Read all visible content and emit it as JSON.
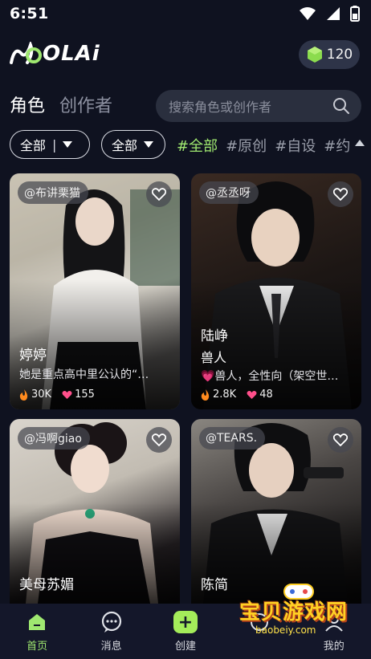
{
  "status": {
    "time": "6:51"
  },
  "header": {
    "logo_text": "OLAi",
    "logo_prefix": "M",
    "coins": "120"
  },
  "tabs": {
    "active": "角色",
    "inactive": "创作者"
  },
  "search": {
    "placeholder": "搜索角色或创作者"
  },
  "filters": {
    "dropdown1": "全部",
    "dropdown2": "全部",
    "hashtags": [
      "#全部",
      "#原创",
      "#自设",
      "#约"
    ]
  },
  "cards": [
    {
      "author": "@布讲栗猫",
      "name": "婷婷",
      "desc": "她是重点高中里公认的“…",
      "hot": "30K",
      "likes": "155"
    },
    {
      "author": "@丞丞呀",
      "name": "陆峥",
      "subtitle": "兽人",
      "desc": "💗兽人，全性向（架空世…",
      "hot": "2.8K",
      "likes": "48"
    },
    {
      "author": "@冯啊giao",
      "name": "美母苏媚",
      "desc": ""
    },
    {
      "author": "@TEARS.",
      "name": "陈简",
      "desc": ""
    }
  ],
  "nav": {
    "home": "首页",
    "messages": "消息",
    "create": "创建",
    "discover": "",
    "mine": "我的"
  },
  "watermark": {
    "title": "宝贝游戏网",
    "url": "baobeiy.com"
  },
  "colors": {
    "accent": "#9fe870",
    "background": "#0f1220",
    "pill": "#2a2f3e"
  }
}
